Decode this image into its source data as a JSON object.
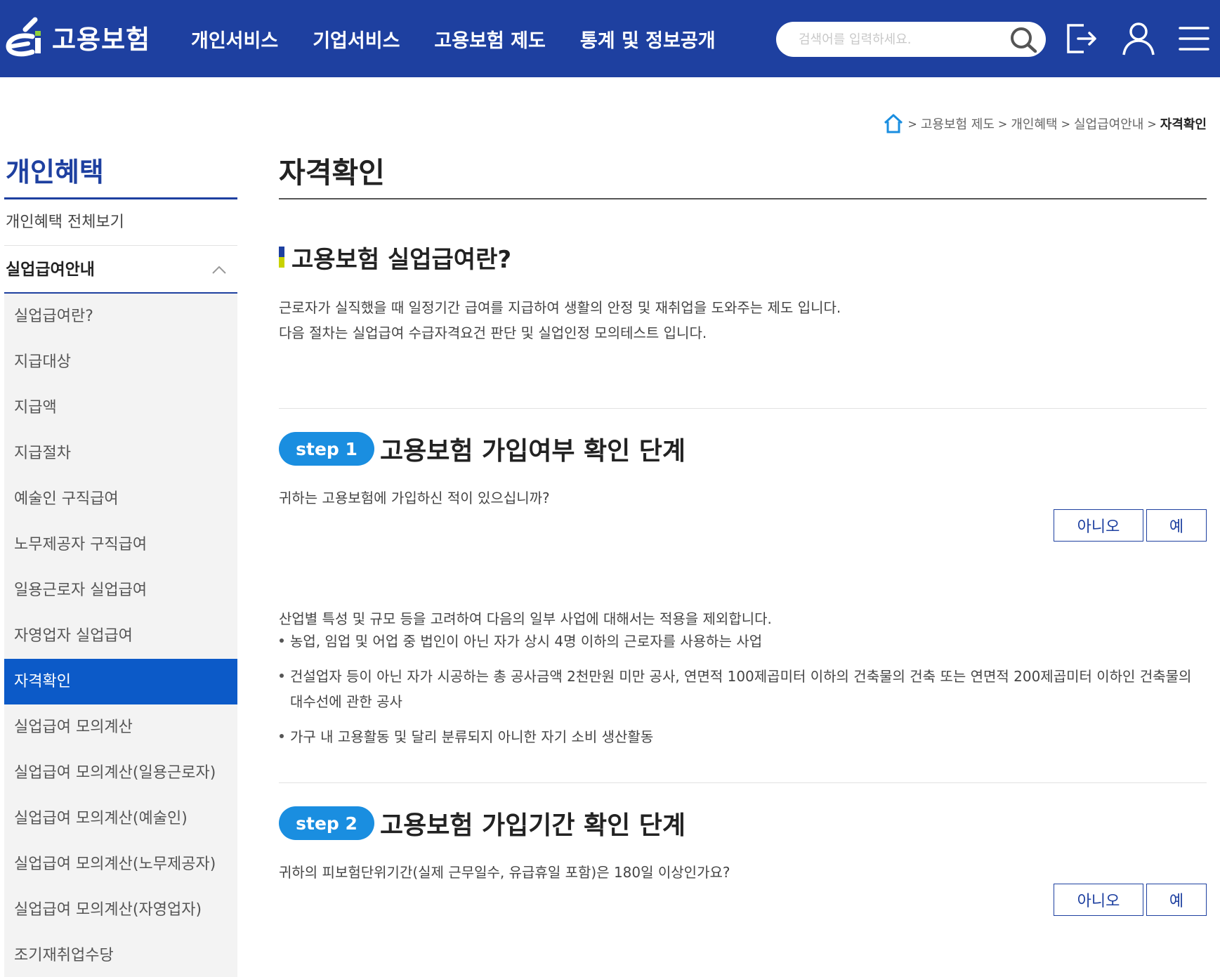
{
  "header": {
    "logo_text": "고용보험",
    "nav": [
      "개인서비스",
      "기업서비스",
      "고용보험 제도",
      "통계 및 정보공개"
    ],
    "search_placeholder": "검색어를 입력하세요.",
    "colors": {
      "bar": "#1e40a0",
      "accent": "#1a8ee0",
      "active": "#0c5ac8"
    }
  },
  "breadcrumb": {
    "items": [
      "고용보험 제도",
      "개인혜택",
      "실업급여안내"
    ],
    "current": "자격확인"
  },
  "sidebar": {
    "title": "개인혜택",
    "all": "개인혜택 전체보기",
    "group": "실업급여안내",
    "items": [
      "실업급여란?",
      "지급대상",
      "지급액",
      "지급절차",
      "예술인 구직급여",
      "노무제공자 구직급여",
      "일용근로자 실업급여",
      "자영업자 실업급여",
      "자격확인",
      "실업급여 모의계산",
      "실업급여 모의계산(일용근로자)",
      "실업급여 모의계산(예술인)",
      "실업급여 모의계산(노무제공자)",
      "실업급여 모의계산(자영업자)",
      "조기재취업수당"
    ],
    "active_item": "자격확인"
  },
  "main": {
    "page_title": "자격확인",
    "section_title": "고용보험 실업급여란?",
    "intro": [
      "근로자가 실직했을 때 일정기간 급여를 지급하여 생활의 안정 및 재취업을 도와주는 제도 입니다.",
      "다음 절차는 실업급여 수급자격요건 판단 및 실업인정 모의테스트 입니다."
    ],
    "steps": [
      {
        "badge": "step  1",
        "title": "고용보험 가입여부 확인 단계",
        "question": "귀하는 고용보험에 가입하신 적이 있으십니까?",
        "no": "아니오",
        "yes": "예"
      },
      {
        "badge": "step  2",
        "title": "고용보험 가입기간 확인 단계",
        "question": "귀하의 피보험단위기간(실제 근무일수, 유급휴일 포함)은 180일 이상인가요?",
        "no": "아니오",
        "yes": "예"
      }
    ],
    "note": "산업별 특성 및 규모 등을 고려하여 다음의 일부 사업에 대해서는 적용을 제외합니다.",
    "bullets": [
      "농업, 임업 및 어업 중 법인이 아닌 자가 상시 4명 이하의 근로자를 사용하는 사업",
      "건설업자 등이 아닌 자가 시공하는 총 공사금액 2천만원 미만 공사, 연면적 100제곱미터 이하의 건축물의 건축 또는 연면적 200제곱미터 이하인 건축물의 대수선에 관한 공사",
      "가구 내 고용활동 및 달리 분류되지 아니한 자기 소비 생산활동"
    ]
  }
}
